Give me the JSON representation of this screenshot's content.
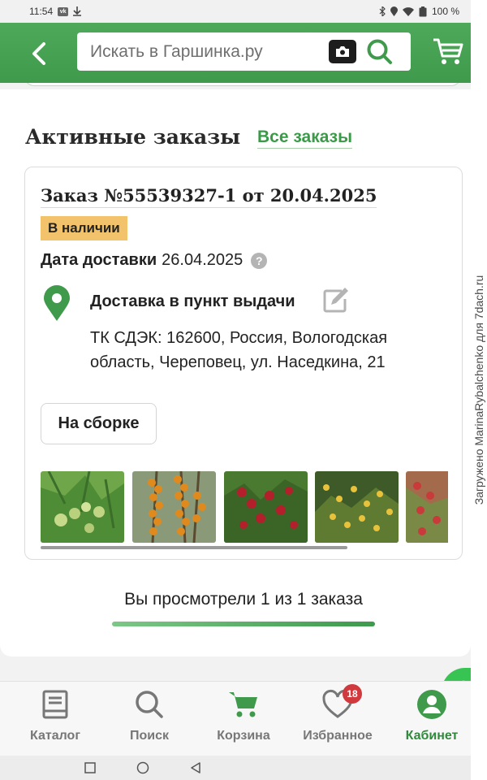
{
  "status_bar": {
    "time": "11:54",
    "vk_label": "vk",
    "battery": "100 %"
  },
  "header": {
    "search_placeholder": "Искать в Гаршинка.ру",
    "icons": [
      "back-arrow-icon",
      "camera-icon",
      "search-icon",
      "cart-icon"
    ]
  },
  "active_orders": {
    "title": "Активные заказы",
    "all_orders_link": "Все заказы",
    "order": {
      "title": "Заказ №55539327-1 от 20.04.2025",
      "badge": "В наличии",
      "delivery_date_label": "Дата доставки",
      "delivery_date": "26.04.2025",
      "delivery_method": "Доставка в пункт выдачи",
      "address": "ТК СДЭК: 162600, Россия, Вологодская область, Череповец, ул. Наседкина, 21",
      "status_button": "На сборке",
      "product_thumbnails": [
        "gooseberry",
        "sea-buckthorn",
        "red-berries",
        "yellow-fruit-tree",
        "red-fruit-tree"
      ]
    }
  },
  "pagination": {
    "text": "Вы просмотрели 1 из 1 заказа",
    "progress": 1.0
  },
  "bottom_nav": {
    "items": [
      {
        "label": "Каталог",
        "icon": "catalog-book-icon"
      },
      {
        "label": "Поиск",
        "icon": "search-icon"
      },
      {
        "label": "Корзина",
        "icon": "cart-icon"
      },
      {
        "label": "Избранное",
        "icon": "heart-icon"
      },
      {
        "label": "Кабинет",
        "icon": "user-icon",
        "active": true
      }
    ],
    "favorites_count": "18"
  },
  "colors": {
    "brand_green": "#3f9a4c",
    "badge_yellow": "#f2c36b",
    "badge_red": "#d0393d",
    "whatsapp_green": "#37c453"
  },
  "watermark": "Загружено MarinaRybalchenko для 7dach.ru"
}
